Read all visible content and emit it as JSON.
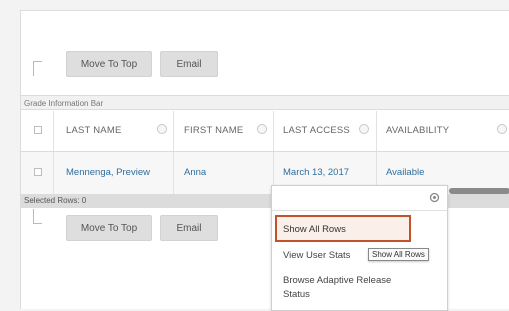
{
  "toolbar_top": {
    "move_to_top": "Move To Top",
    "email": "Email"
  },
  "info_bar": "Grade Information Bar",
  "columns": [
    {
      "label": "LAST NAME"
    },
    {
      "label": "FIRST NAME"
    },
    {
      "label": "LAST ACCESS"
    },
    {
      "label": "AVAILABILITY"
    }
  ],
  "rows": [
    {
      "last_name": "Mennenga, Preview",
      "first_name": "Anna",
      "last_access": "March 13, 2017",
      "availability": "Available"
    }
  ],
  "selected_rows": "Selected Rows: 0",
  "toolbar_bottom": {
    "move_to_top": "Move To Top",
    "email": "Email"
  },
  "menu": {
    "items": [
      "Show All Rows",
      "View User Stats",
      "Browse Adaptive Release Status"
    ],
    "tooltip": "Show All Rows",
    "accent": "#c0522c"
  }
}
